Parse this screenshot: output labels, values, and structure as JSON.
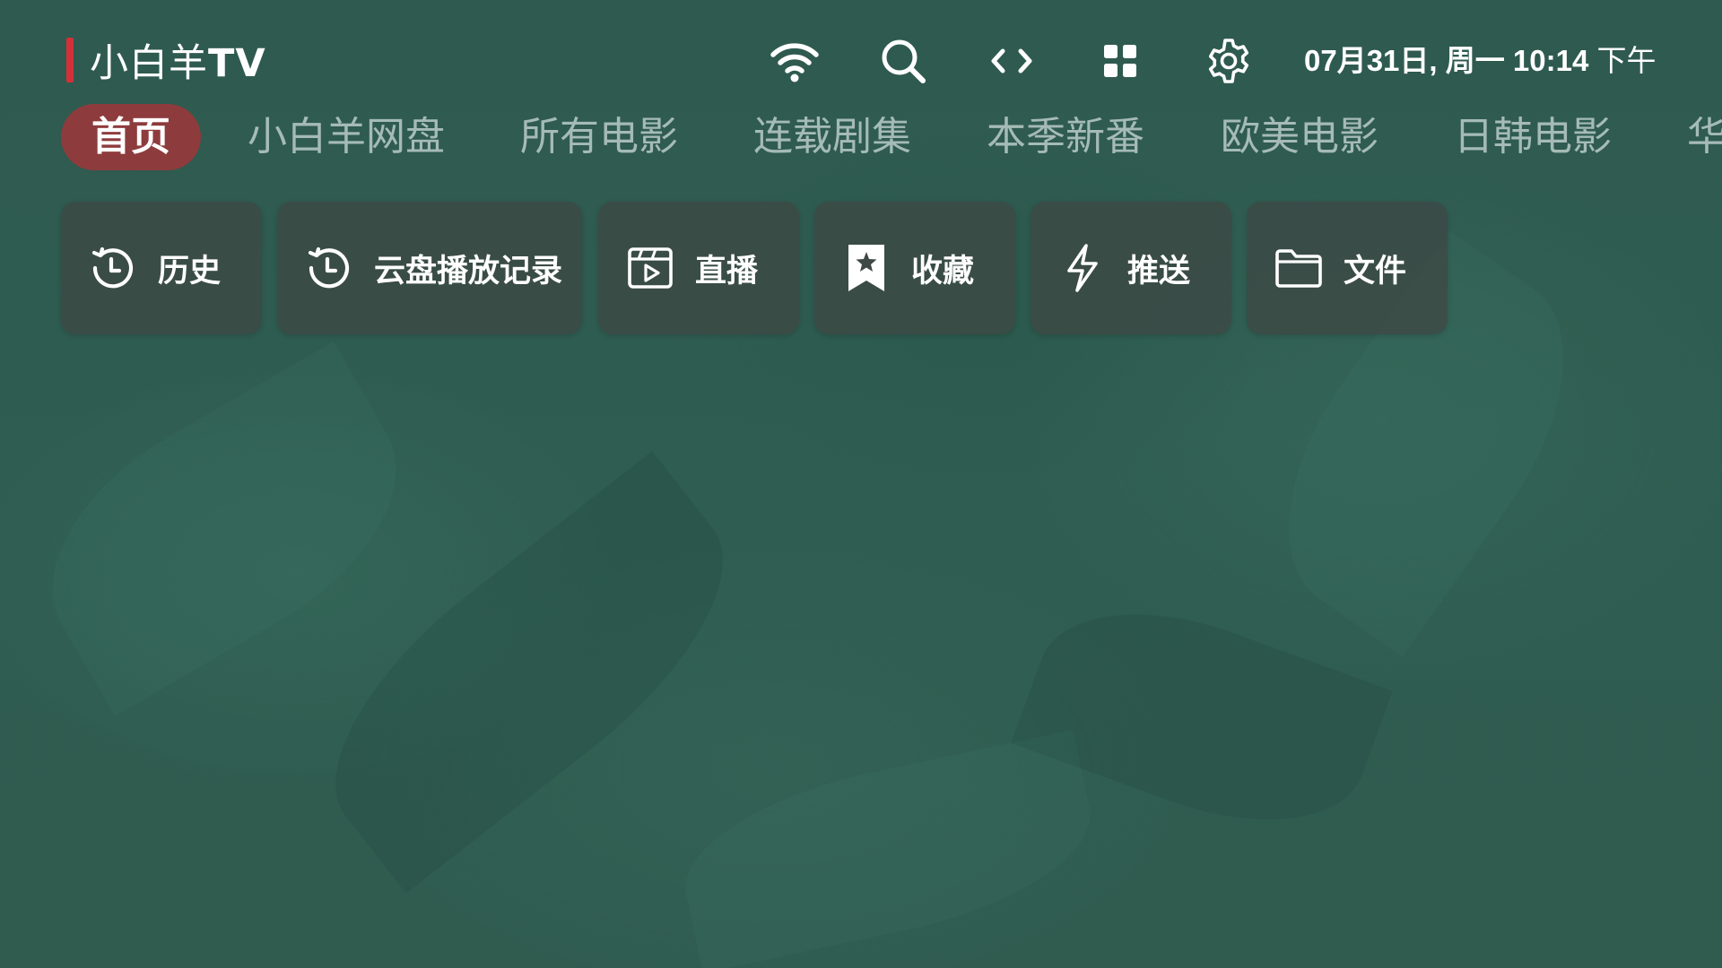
{
  "app": {
    "title_main": "小白羊",
    "title_suffix": "TV",
    "accent_color": "#d4303a"
  },
  "toolbar": {
    "icons": [
      "wifi-icon",
      "search-icon",
      "code-arrows-icon",
      "grid-apps-icon",
      "gear-icon"
    ]
  },
  "clock": {
    "date": "07月31日, 周一",
    "time": "10:14",
    "period": "下午"
  },
  "tabs": [
    {
      "label": "首页",
      "active": true
    },
    {
      "label": "小白羊网盘",
      "active": false
    },
    {
      "label": "所有电影",
      "active": false
    },
    {
      "label": "连载剧集",
      "active": false
    },
    {
      "label": "本季新番",
      "active": false
    },
    {
      "label": "欧美电影",
      "active": false
    },
    {
      "label": "日韩电影",
      "active": false
    },
    {
      "label": "华",
      "active": false
    }
  ],
  "quick_actions": [
    {
      "label": "历史",
      "icon": "history-icon"
    },
    {
      "label": "云盘播放记录",
      "icon": "history-icon"
    },
    {
      "label": "直播",
      "icon": "play-clapper-icon"
    },
    {
      "label": "收藏",
      "icon": "bookmark-star-icon"
    },
    {
      "label": "推送",
      "icon": "lightning-icon"
    },
    {
      "label": "文件",
      "icon": "folder-icon"
    }
  ],
  "colors": {
    "active_tab_bg": "#8e3b3d",
    "background": "#2f5b4f"
  }
}
